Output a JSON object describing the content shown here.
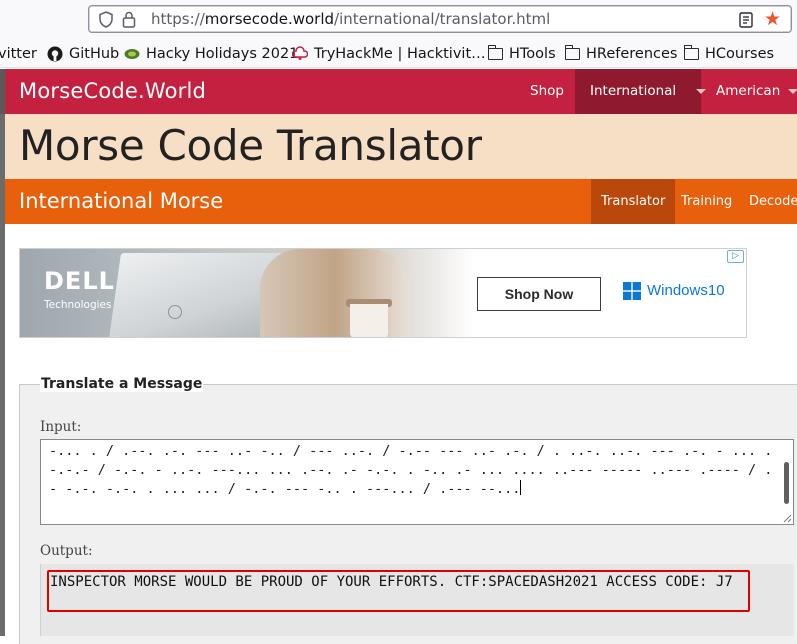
{
  "browser": {
    "url_scheme": "https://",
    "url_host": "morsecode.world",
    "url_path": "/international/translator.html",
    "bookmarks": [
      {
        "label": "vitter",
        "icon": "twitter-icon"
      },
      {
        "label": "GitHub",
        "icon": "github-icon"
      },
      {
        "label": "Hacky Holidays 2021",
        "icon": "hacky-holidays-icon"
      },
      {
        "label": "TryHackMe | Hacktivit…",
        "icon": "tryhackme-icon"
      },
      {
        "label": "HTools",
        "icon": "folder-icon"
      },
      {
        "label": "HReferences",
        "icon": "folder-icon"
      },
      {
        "label": "HCourses",
        "icon": "folder-icon"
      }
    ]
  },
  "site": {
    "brand": "MorseCode.World",
    "nav": [
      {
        "label": "Shop"
      },
      {
        "label": "International"
      },
      {
        "label": "American"
      }
    ],
    "page_title": "Morse Code Translator",
    "section_title": "International Morse",
    "subnav": [
      {
        "label": "Translator"
      },
      {
        "label": "Training"
      },
      {
        "label": "Decoder"
      }
    ]
  },
  "ad": {
    "brand": "DELL",
    "brand_sub": "Technologies",
    "cta": "Shop Now",
    "partner": "Windows10"
  },
  "translator": {
    "legend": "Translate a Message",
    "input_label": "Input:",
    "input_value": "-... . / .--. .-. --- ..- -.. / --- ..-. / -.-- --- ..- .-. / . ..-. ..-. --- .-. - ... .-.-.- / -.-. - ..-. ---... ... .--. .- -.-. . -.. .- ... .... ..--- ----- ..--- .---- / .- -.-. -.-. . ... ... / -.-. --- -.. . ---... / .--- --...",
    "output_label": "Output:",
    "output_value": "INSPECTOR MORSE WOULD BE PROUD OF YOUR EFFORTS. CTF:SPACEDASH2021 ACCESS CODE: J7"
  },
  "colors": {
    "nav_bg": "#c3213f",
    "nav_active": "#8f1a30",
    "hero_bg": "#f7dfc5",
    "subnav_bg": "#e8600c",
    "subnav_active": "#b9480a",
    "highlight_border": "#e00000"
  }
}
